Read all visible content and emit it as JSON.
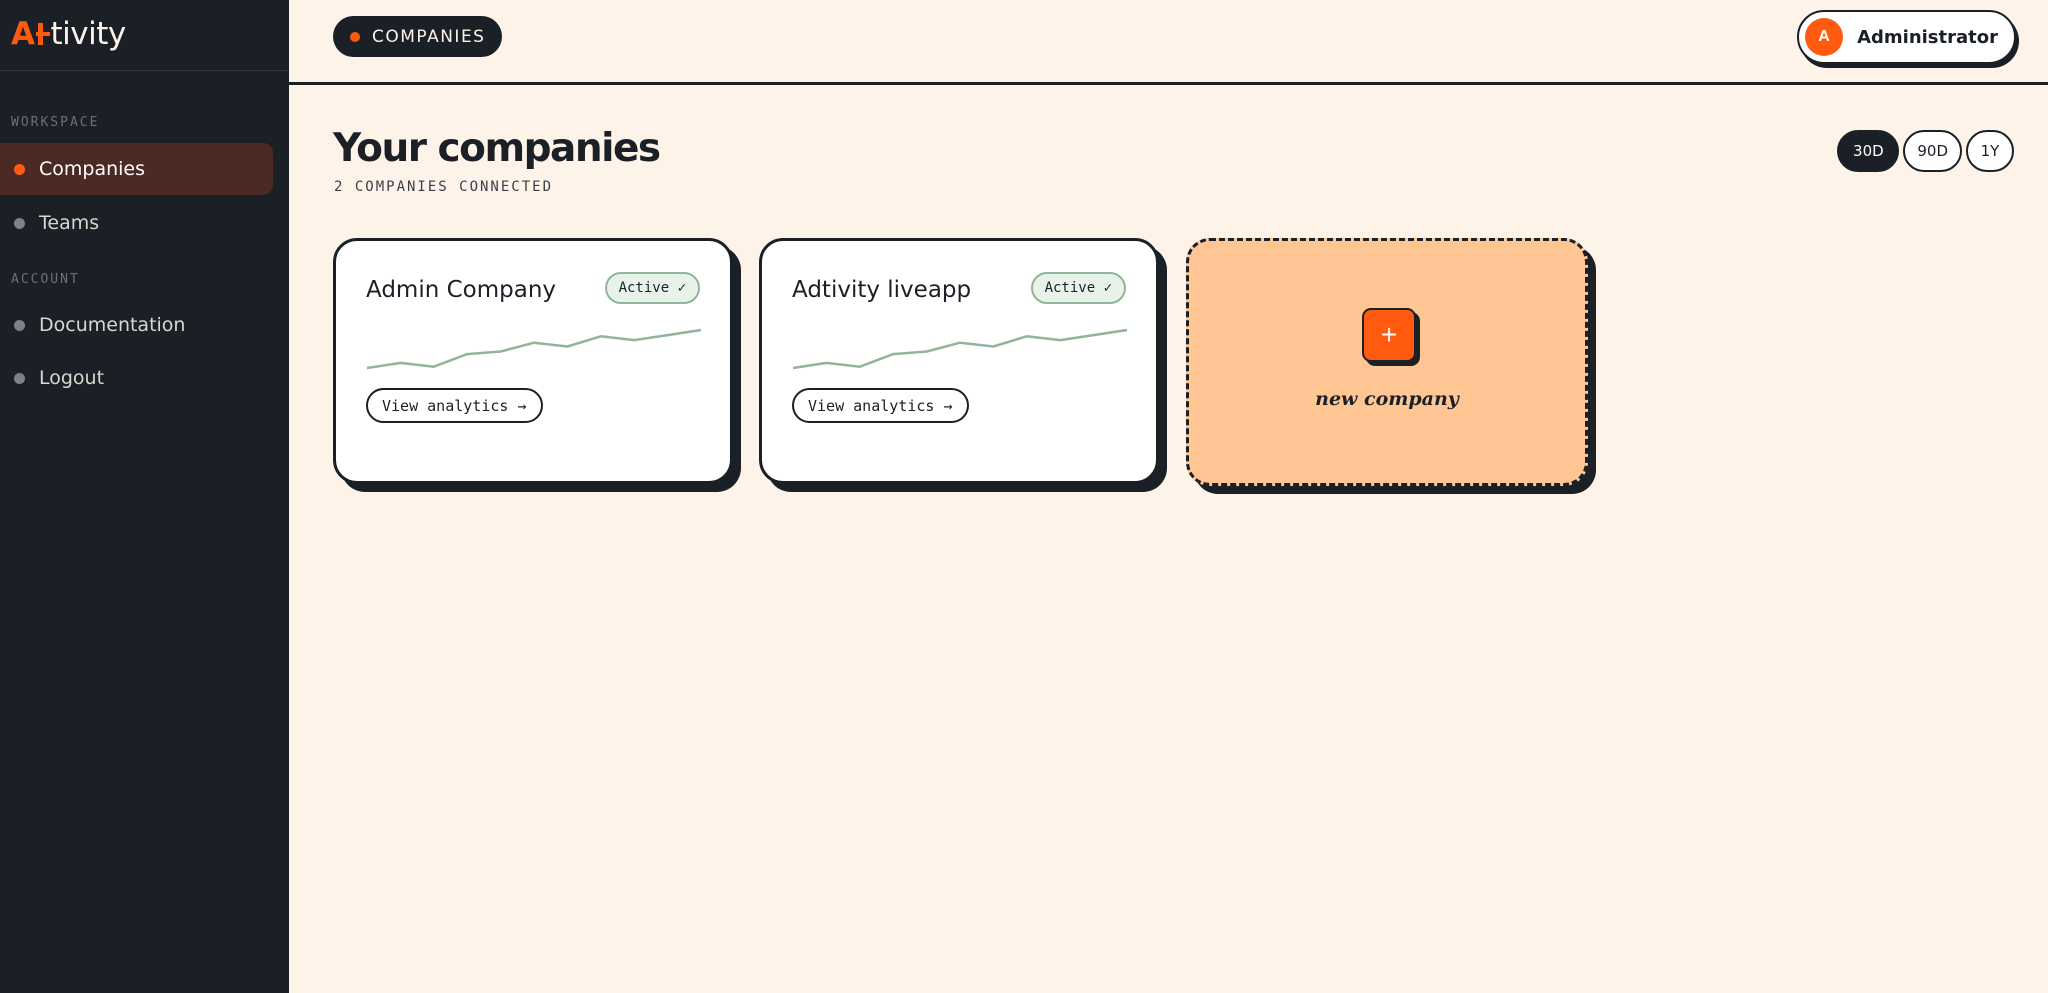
{
  "brand": {
    "name_first": "A",
    "name_rest": "tivity"
  },
  "sidebar": {
    "sections": [
      {
        "label": "WORKSPACE",
        "items": [
          {
            "label": "Companies",
            "active": true
          },
          {
            "label": "Teams",
            "active": false
          }
        ]
      },
      {
        "label": "ACCOUNT",
        "items": [
          {
            "label": "Documentation",
            "active": false
          },
          {
            "label": "Logout",
            "active": false
          }
        ]
      }
    ]
  },
  "header": {
    "breadcrumb": "COMPANIES",
    "user": {
      "initial": "A",
      "name": "Administrator"
    }
  },
  "main": {
    "title": "Your companies",
    "subtitle": "2 COMPANIES CONNECTED",
    "ranges": [
      {
        "label": "30D",
        "active": true
      },
      {
        "label": "90D",
        "active": false
      },
      {
        "label": "1Y",
        "active": false
      }
    ],
    "companies": [
      {
        "name": "Admin Company",
        "status": "Active ✓",
        "action": "View analytics →",
        "trend": [
          5,
          9,
          6,
          16,
          18,
          25,
          22,
          30,
          27,
          31,
          35
        ]
      },
      {
        "name": "Adtivity liveapp",
        "status": "Active ✓",
        "action": "View analytics →",
        "trend": [
          5,
          9,
          6,
          16,
          18,
          25,
          22,
          30,
          27,
          31,
          35
        ]
      }
    ],
    "new_company": {
      "icon": "+",
      "label": "new company"
    }
  },
  "colors": {
    "accent": "#ff5a0f",
    "sidebar_bg": "#1b2027",
    "page_bg": "#fdf3e8",
    "sparkline": "#8fb59b",
    "new_card_bg": "#ffc593"
  }
}
